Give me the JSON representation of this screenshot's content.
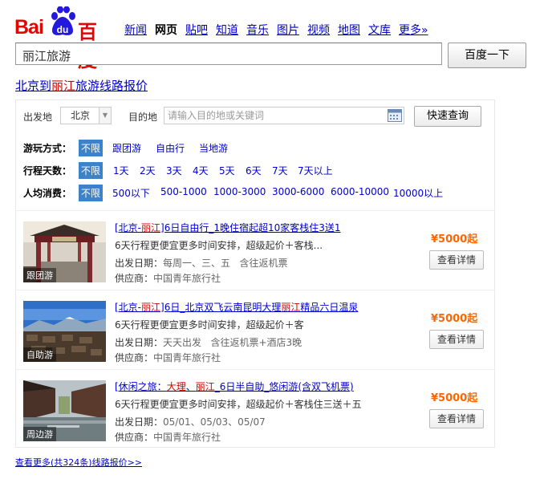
{
  "logo": {
    "latin": "Bai",
    "badge": "du",
    "cn": "百度"
  },
  "nav": [
    "新闻",
    "网页",
    "贴吧",
    "知道",
    "音乐",
    "图片",
    "视频",
    "地图",
    "文库",
    "更多»"
  ],
  "nav_current": 1,
  "search": {
    "value": "丽江旅游",
    "button": "百度一下"
  },
  "result_title": {
    "pre": "北京到",
    "hl": "丽江",
    "post": "旅游线路报价"
  },
  "filter": {
    "from_label": "出发地",
    "from_value": "北京",
    "to_label": "目的地",
    "to_placeholder": "请输入目的地或关键词",
    "query_button": "快速查询",
    "rows": [
      {
        "key": "游玩方式：",
        "options": [
          "不限",
          "跟团游",
          "自由行",
          "当地游"
        ]
      },
      {
        "key": "行程天数：",
        "options": [
          "不限",
          "1天",
          "2天",
          "3天",
          "4天",
          "5天",
          "6天",
          "7天",
          "7天以上"
        ]
      },
      {
        "key": "人均消费：",
        "options": [
          "不限",
          "500以下",
          "500-1000",
          "1000-3000",
          "3000-6000",
          "6000-10000",
          "10000以上"
        ]
      }
    ]
  },
  "items": [
    {
      "tag": "跟团游",
      "title": [
        {
          "t": "[北京-"
        },
        {
          "t": "丽江",
          "hl": true
        },
        {
          "t": "]6日自由行_1晚住宿起超10家客栈住3送1"
        }
      ],
      "desc": "6天行程更便宜更多时间安排，超级起价＋客栈...",
      "date_label": "出发日期：",
      "date": "每周一、三、五",
      "extra": "含往返机票",
      "supplier_label": "供应商：",
      "supplier": "中国青年旅行社",
      "price": "¥5000起",
      "button": "查看详情"
    },
    {
      "tag": "自助游",
      "title": [
        {
          "t": "[北京-"
        },
        {
          "t": "丽江",
          "hl": true
        },
        {
          "t": "]6日_北京双飞云南昆明大理"
        },
        {
          "t": "丽江",
          "hl": true
        },
        {
          "t": "精品六日温泉"
        }
      ],
      "desc": "6天行程更便宜更多时间安排，超级起价＋客",
      "date_label": "出发日期：",
      "date": "天天出发",
      "extra": "含往返机票+酒店3晚",
      "supplier_label": "供应商：",
      "supplier": "中国青年旅行社",
      "price": "¥5000起",
      "button": "查看详情"
    },
    {
      "tag": "周边游",
      "title": [
        {
          "t": "[休闲之旅："
        },
        {
          "t": "大理",
          "hl": true
        },
        {
          "t": "、"
        },
        {
          "t": "丽江",
          "hl": true
        },
        {
          "t": "_6日半自助_悠闲游(含双飞机票)"
        }
      ],
      "desc": "6天行程更便宜更多时间安排，超级起价＋客栈住三送＋五",
      "date_label": "出发日期：",
      "date": "05/01、05/03、05/07",
      "extra": "",
      "supplier_label": "供应商：",
      "supplier": "中国青年旅行社",
      "price": "¥5000起",
      "button": "查看详情"
    }
  ],
  "more_link": "查看更多(共324条)线路报价>>",
  "colors": {
    "brand_red": "#e10602",
    "brand_blue": "#2319dc",
    "link": "#0000cc",
    "price": "#ff6600",
    "chip": "#3e83c8"
  }
}
